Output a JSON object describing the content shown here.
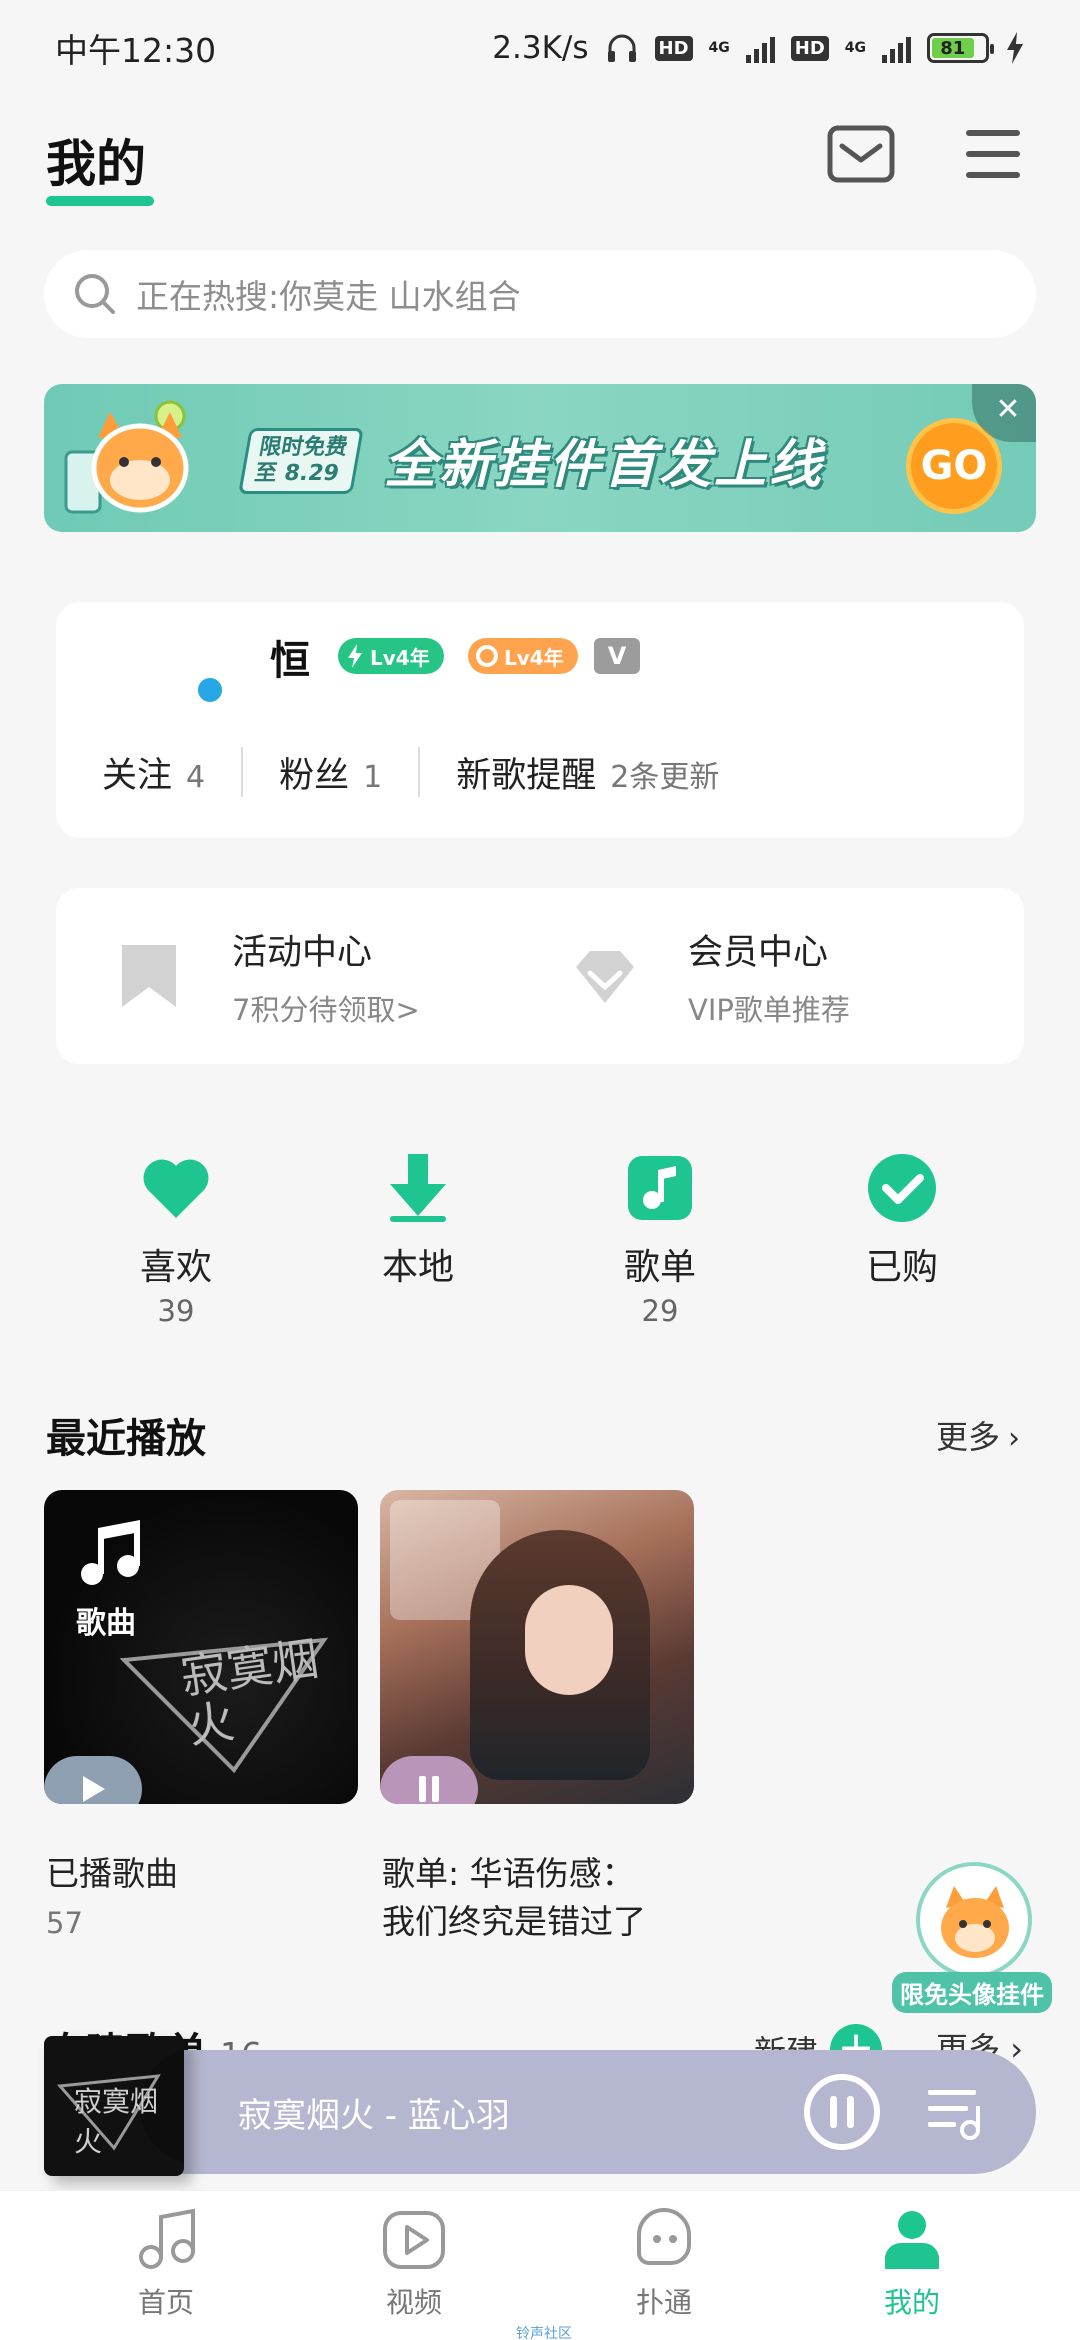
{
  "status_bar": {
    "time": "中午12:30",
    "speed": "2.3K/s",
    "hd1": "HD",
    "hd2": "HD",
    "net1": "4G",
    "net2": "4G",
    "battery": "81"
  },
  "header": {
    "title": "我的"
  },
  "search": {
    "placeholder": "正在热搜:你莫走 山水组合"
  },
  "banner": {
    "tag_line1": "限时免费",
    "tag_line2": "至 8.29",
    "headline": "全新挂件首发上线",
    "go": "GO",
    "close": "✕"
  },
  "profile": {
    "username": "恒",
    "badge1": "Lv4年",
    "badge2": "Lv4年",
    "badge3": "V",
    "stats": [
      {
        "label": "关注",
        "value": "4"
      },
      {
        "label": "粉丝",
        "value": "1"
      },
      {
        "label": "新歌提醒",
        "value": "2条更新"
      }
    ]
  },
  "centers": [
    {
      "title": "活动中心",
      "sub": "7积分待领取>"
    },
    {
      "title": "会员中心",
      "sub": "VIP歌单推荐"
    }
  ],
  "shortcuts": [
    {
      "label": "喜欢",
      "count": "39",
      "icon": "heart-icon"
    },
    {
      "label": "本地",
      "count": "",
      "icon": "download-icon"
    },
    {
      "label": "歌单",
      "count": "29",
      "icon": "playlist-icon"
    },
    {
      "label": "已购",
      "count": "",
      "icon": "check-icon"
    }
  ],
  "recent": {
    "title": "最近播放",
    "more": "更多",
    "items": [
      {
        "cover_label": "歌曲",
        "art_text": "寂寞烟火",
        "caption": "已播歌曲",
        "count": "57"
      },
      {
        "caption_line1": "歌单: 华语伤感：",
        "caption_line2": "我们终究是错过了"
      }
    ]
  },
  "pendant": {
    "label": "限免头像挂件"
  },
  "created": {
    "title": "自建歌单",
    "count": "16",
    "new": "新建",
    "more": "更多"
  },
  "player": {
    "title": "寂寞烟火 - 蓝心羽",
    "art_text": "寂寞烟火"
  },
  "nav": {
    "items": [
      {
        "label": "首页"
      },
      {
        "label": "视频"
      },
      {
        "label": "扑通"
      },
      {
        "label": "我的"
      }
    ],
    "sub": "铃声社区"
  },
  "colors": {
    "accent": "#1fc590",
    "background": "#f6f6f6",
    "player": "#b5b6cf"
  }
}
